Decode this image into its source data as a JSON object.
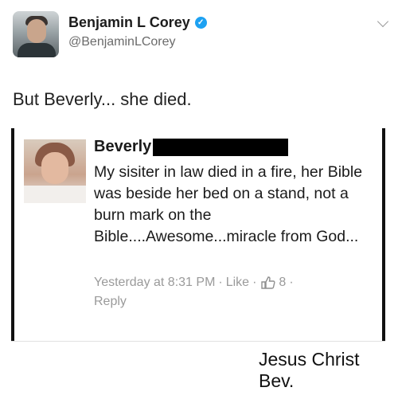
{
  "tweet": {
    "author_name": "Benjamin L Corey",
    "handle": "@BenjaminLCorey",
    "text": "But Beverly... she died."
  },
  "embedded_comment": {
    "commenter_name": "Beverly",
    "comment_text": "My sisiter in law died in a fire, her Bible was beside her bed on a stand, not a burn mark on the Bible....Awesome...miracle from God...",
    "timestamp": "Yesterday at 8:31 PM",
    "like_label": "Like",
    "like_count": "8",
    "reply_label": "Reply"
  },
  "caption": "Jesus Christ Bev.",
  "colors": {
    "verified_badge": "#1da1f2",
    "meta_text": "#9a9a9a",
    "redaction": "#000000"
  }
}
